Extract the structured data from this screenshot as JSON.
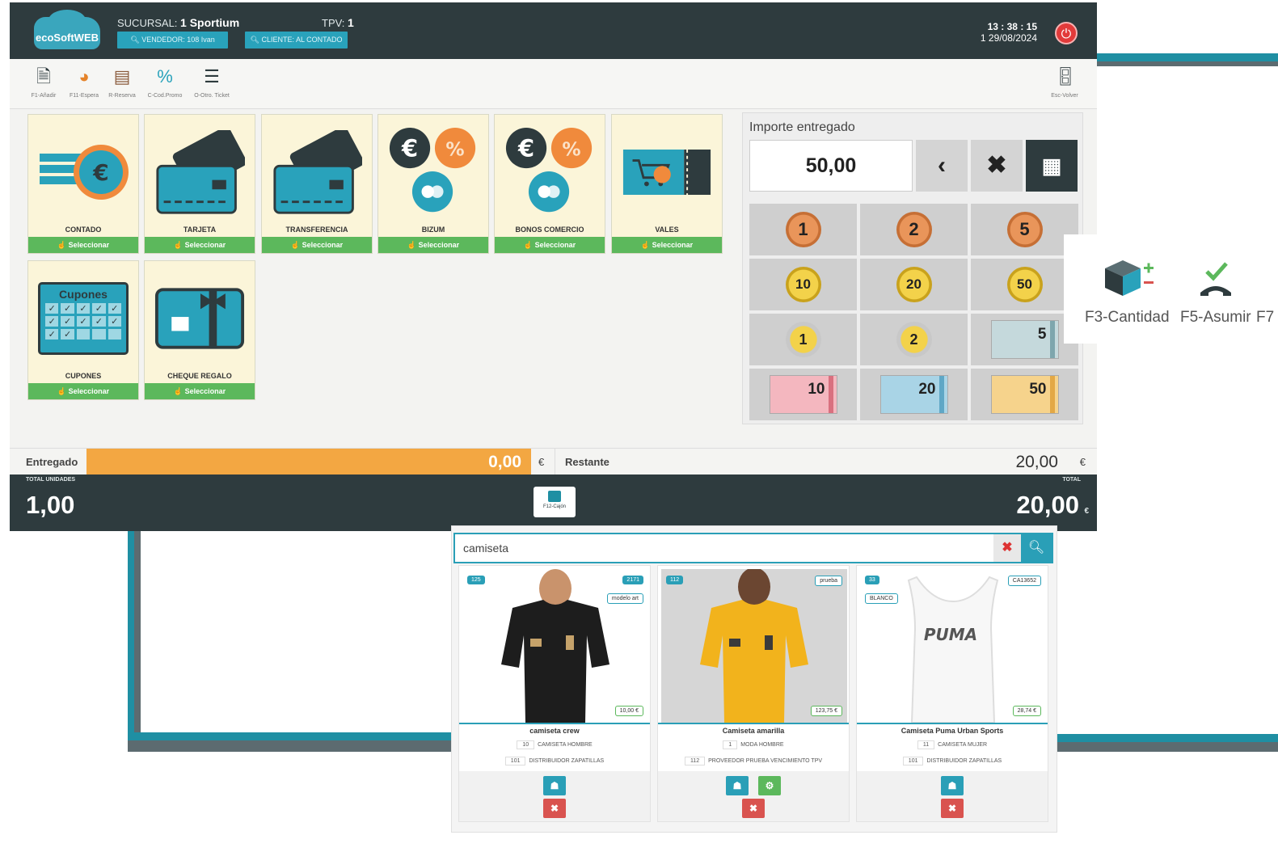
{
  "topbar": {
    "logo": "ecoSoftWEB",
    "sucursal_label": "SUCURSAL:",
    "sucursal_value": "1 Sportium",
    "tpv_label": "TPV:",
    "tpv_value": "1",
    "vendedor_button": "VENDEDOR: 108 Ivan",
    "cliente_button": "CLIENTE: AL CONTADO",
    "time": "13 : 38 : 15",
    "date": "1 29/08/2024"
  },
  "toolbar": {
    "items": [
      {
        "label": "F1-Añadir",
        "icon": "add-document-icon"
      },
      {
        "label": "F11-Espera",
        "icon": "user-wait-icon"
      },
      {
        "label": "R-Reserva",
        "icon": "reserve-icon"
      },
      {
        "label": "C-Cod.Promo",
        "icon": "percent-icon"
      },
      {
        "label": "O-Otro. Ticket",
        "icon": "ticket-icon"
      }
    ],
    "back_label": "Esc-Volver"
  },
  "payment_methods": [
    {
      "label": "CONTADO",
      "select": "Seleccionar"
    },
    {
      "label": "TARJETA",
      "select": "Seleccionar"
    },
    {
      "label": "TRANSFERENCIA",
      "select": "Seleccionar"
    },
    {
      "label": "BIZUM",
      "select": "Seleccionar"
    },
    {
      "label": "BONOS COMERCIO",
      "select": "Seleccionar"
    },
    {
      "label": "VALES",
      "select": "Seleccionar"
    },
    {
      "label": "CUPONES",
      "select": "Seleccionar",
      "art_text": "Cupones"
    },
    {
      "label": "CHEQUE REGALO",
      "select": "Seleccionar"
    }
  ],
  "calculator": {
    "label": "Importe entregado",
    "amount": "50,00",
    "cash": [
      {
        "value": "1",
        "kind": "cent"
      },
      {
        "value": "2",
        "kind": "cent"
      },
      {
        "value": "5",
        "kind": "cent"
      },
      {
        "value": "10",
        "kind": "cent-gold"
      },
      {
        "value": "20",
        "kind": "cent-gold"
      },
      {
        "value": "50",
        "kind": "cent-gold"
      },
      {
        "value": "1",
        "kind": "euro-coin"
      },
      {
        "value": "2",
        "kind": "euro-coin"
      },
      {
        "value": "5",
        "kind": "note",
        "color": "#c5d9dc"
      },
      {
        "value": "10",
        "kind": "note",
        "color": "#f4b7bf"
      },
      {
        "value": "20",
        "kind": "note",
        "color": "#a9d4e6"
      },
      {
        "value": "50",
        "kind": "note",
        "color": "#f6d38c"
      }
    ]
  },
  "status": {
    "entregado_label": "Entregado",
    "entregado_value": "0,00",
    "currency": "€",
    "restante_label": "Restante",
    "restante_value": "20,00"
  },
  "totals": {
    "units_label": "TOTAL UNIDADES",
    "units_value": "1,00",
    "cajon_label": "F12-Cajón",
    "total_label": "TOTAL",
    "total_value": "20,00",
    "total_currency": "€"
  },
  "side_actions": [
    {
      "label": "F3-Cantidad",
      "icon": "box-plus-minus-icon"
    },
    {
      "label": "F5-Asumir",
      "icon": "assume-check-icon"
    },
    {
      "label": "F7",
      "icon": ""
    }
  ],
  "search": {
    "query": "camiseta",
    "results": [
      {
        "badge_left": "125",
        "badge_right": "2171",
        "tag": "modelo art",
        "price": "10,00 €",
        "name": "camiseta crew",
        "line1_code": "10",
        "line1_text": "CAMISETA HOMBRE",
        "line2_code": "101",
        "line2_text": "DISTRIBUIDOR ZAPATILLAS",
        "shirt_color": "#1d1d1d"
      },
      {
        "badge_left": "112",
        "badge_right": "prueba",
        "tag": "",
        "price": "123,75 €",
        "name": "Camiseta amarilla",
        "line1_code": "1",
        "line1_text": "MODA HOMBRE",
        "line2_code": "112",
        "line2_text": "PROVEEDOR PRUEBA VENCIMIENTO TPV",
        "shirt_color": "#f2b31c"
      },
      {
        "badge_left": "33",
        "badge_right": "CA13652",
        "tag": "BLANCO",
        "price": "28,74 €",
        "name": "Camiseta Puma Urban Sports",
        "line1_code": "11",
        "line1_text": "CAMISETA MUJER",
        "line2_code": "101",
        "line2_text": "DISTRIBUIDOR ZAPATILLAS",
        "shirt_color": "#f7f7f7",
        "print_text": "PUMA"
      }
    ]
  },
  "colors": {
    "dark_bar": "#2e3b3e",
    "accent": "#29a2bb",
    "select_green": "#5cb85c",
    "entregado_orange": "#f3a742",
    "tile_bg": "#fbf5d9"
  }
}
